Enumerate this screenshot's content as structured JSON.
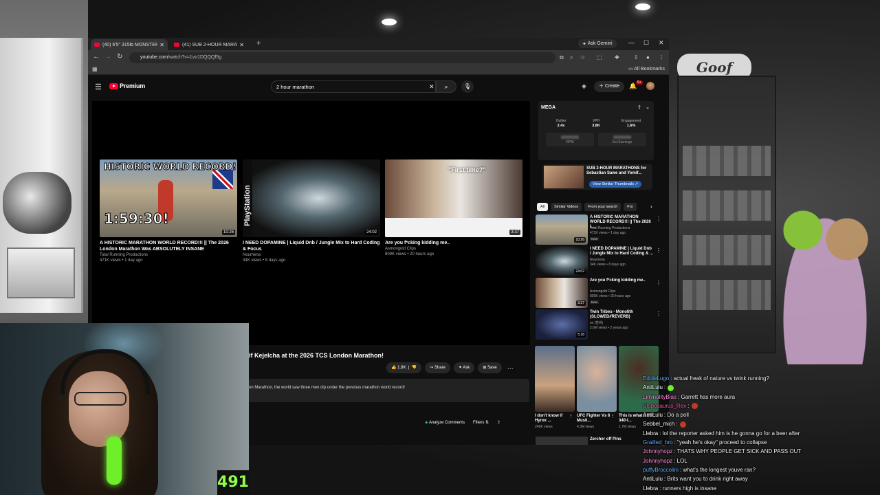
{
  "browser": {
    "tabs": [
      {
        "label": "(40) 6'5\" 315lb MONSTER Gets",
        "active": true
      },
      {
        "label": "(41) SUB 2-HOUR MARATHON",
        "active": false
      }
    ],
    "new_tab": "+",
    "gemini": "Ask Gemini",
    "url_host": "youtube.com",
    "url_path": "/watch?v=1vo1DQQQf5g",
    "all_bookmarks": "All Bookmarks"
  },
  "youtube": {
    "logo": "Premium",
    "search_value": "2 hour marathon",
    "create_label": "Create",
    "notif_count": "9+"
  },
  "endscreen": [
    {
      "title": "A HISTORIC MARATHON WORLD RECORD!!! || The 2026 London Marathon Was ABSOLUTELY INSANE",
      "channel": "Total Running Productions",
      "meta": "471K views • 1 day ago",
      "thumb_text": "HISTORIC WORLD RECORD!",
      "thumb_time": "1:59:30!",
      "duration": "10:26"
    },
    {
      "title": "I NEED DOPAMINE | Liquid Dnb / Jungle Mix to Hard Coding & Focus",
      "channel": "Noumena",
      "meta": "34K views • 8 days ago",
      "thumb_text": "PlayStation",
      "duration": "24:02"
    },
    {
      "title": "Are you f*cking kidding me..",
      "channel": "Asmongold Clips",
      "meta": "809K views • 20 hours ago",
      "thumb_text": "\"First time?\"",
      "duration": "3:37"
    }
  ],
  "video": {
    "title": "if Kejelcha at the 2026 TCS London Marathon!",
    "likes": "1.8K",
    "share": "Share",
    "ask": "Ask",
    "save": "Save",
    "description": "on Marathon, the world saw three men dip under the previous marathon world record!",
    "analyze": "Analyze Comments",
    "filters": "Filters"
  },
  "extension": {
    "logo": "MEGA",
    "stats": [
      {
        "label": "Outlier",
        "value": "2.4x"
      },
      {
        "label": "VPH",
        "value": "3.8K"
      },
      {
        "label": "Engagement",
        "value": "1.6%"
      }
    ],
    "blurred": [
      "RPM",
      "Est Earnings"
    ]
  },
  "promo": {
    "title": "SUB 2-HOUR MARATHONS for Sebastian Sawe and Yomif...",
    "button": "View Similar Thumbnails"
  },
  "chips": [
    "All",
    "Similar Videos",
    "From your search",
    "Fro"
  ],
  "recommendations": [
    {
      "title": "A HISTORIC MARATHON WORLD RECORD!!! || The 2026 L...",
      "channel": "Total Running Productions",
      "meta": "471K views • 1 day ago",
      "badge": "New",
      "duration": "10:26"
    },
    {
      "title": "I NEED DOPAMINE | Liquid Dnb / Jungle Mix to Hard Coding & ...",
      "channel": "Noumena",
      "meta": "34K views • 8 days ago",
      "badge": "",
      "duration": "24:02"
    },
    {
      "title": "Are you f*cking kidding me..",
      "channel": "Asmongold Clips",
      "meta": "809K views • 20 hours ago",
      "badge": "New",
      "duration": "3:37"
    },
    {
      "title": "Twin Tribes - Monolith (SLOWED//REVERB)",
      "channel": "ov (밤비)",
      "meta": "2.6M views • 2 years ago",
      "badge": "",
      "duration": "5:18"
    }
  ],
  "shorts": [
    {
      "title": "I don't know if Hyrox ...",
      "meta": "249K views"
    },
    {
      "title": "UFC Fighter Vs 6 Musli...",
      "meta": "4.3M views"
    },
    {
      "title": "This is what a 6'8\", 340-l...",
      "meta": "1.7M views"
    }
  ],
  "last_rec": "Zercher off Pins",
  "webcam_counter": "491",
  "chat": [
    {
      "user": "EddieLugo",
      "color": "#5da9ff",
      "text": "actual freak of nature vs twink running?"
    },
    {
      "user": "AntiLulu",
      "color": "#ffffff",
      "text": ""
    },
    {
      "user": "LiminalityBias",
      "color": "#ff8ad8",
      "text": "Garrett has more aura"
    },
    {
      "user": "Sloposaurus_Rex",
      "color": "#ff4fa3",
      "text": ""
    },
    {
      "user": "AntiLulu",
      "color": "#ffffff",
      "text": "Do a poll"
    },
    {
      "user": "Sebbel_mich",
      "color": "#ffffff",
      "text": ""
    },
    {
      "user": "Llebra",
      "color": "#ffffff",
      "text": "lol the reporter asked him is he gonna go for a beer after"
    },
    {
      "user": "Grailled_bro",
      "color": "#5da9ff",
      "text": "\"yeah he's okay\" proceed to collapse"
    },
    {
      "user": "Johnnyhopz",
      "color": "#ff8ad8",
      "text": "THATS WHY PEOPLE GET SICK AND PASS OUT"
    },
    {
      "user": "Johnnyhopz",
      "color": "#ff8ad8",
      "text": "LOL"
    },
    {
      "user": "puffyBroccolini",
      "color": "#5da9ff",
      "text": "what's the longest youve ran?"
    },
    {
      "user": "AntiLulu",
      "color": "#ffffff",
      "text": "Brits want you to drink right away"
    },
    {
      "user": "Llebra",
      "color": "#ffffff",
      "text": "runners high is insane"
    }
  ]
}
